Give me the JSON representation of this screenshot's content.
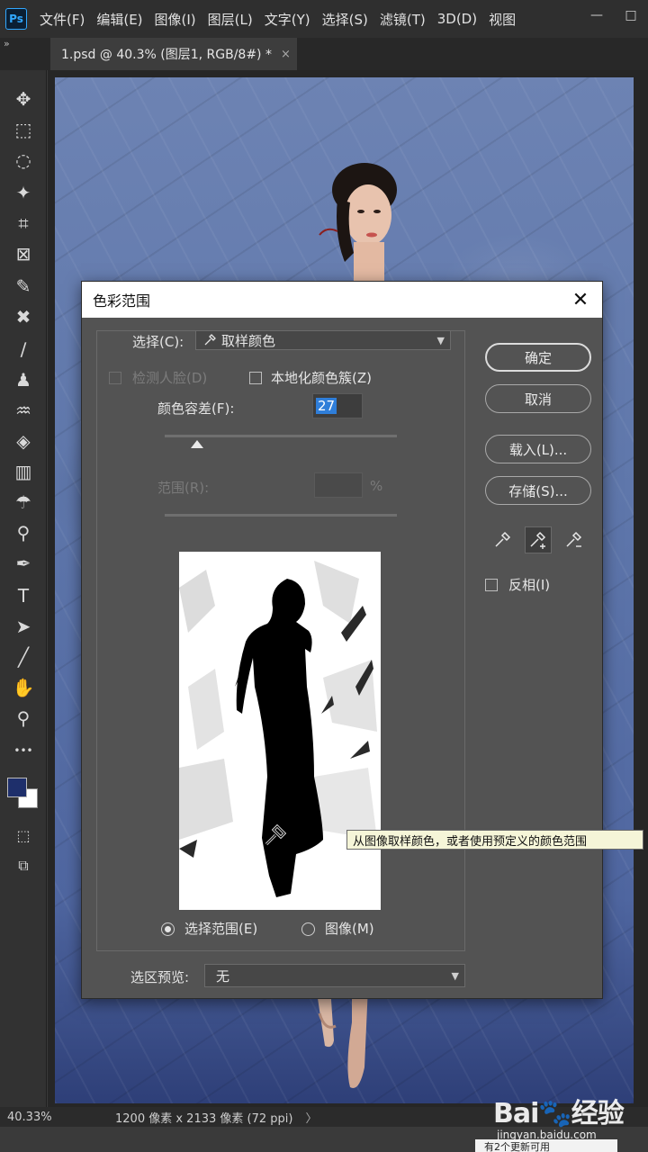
{
  "app": {
    "logo": "Ps",
    "menu": [
      "文件(F)",
      "编辑(E)",
      "图像(I)",
      "图层(L)",
      "文字(Y)",
      "选择(S)",
      "滤镜(T)",
      "3D(D)",
      "视图"
    ],
    "window_controls": {
      "minimize": "—",
      "maximize": "□"
    },
    "panel_toggle": "»"
  },
  "tab": {
    "title": "1.psd @ 40.3% (图层1, RGB/8#) *",
    "close": "×"
  },
  "tools": [
    {
      "name": "move-icon",
      "glyph": "✥"
    },
    {
      "name": "marquee-icon",
      "glyph": "⬚"
    },
    {
      "name": "lasso-icon",
      "glyph": "◌"
    },
    {
      "name": "magic-wand-icon",
      "glyph": "✦"
    },
    {
      "name": "crop-icon",
      "glyph": "⌗"
    },
    {
      "name": "frame-icon",
      "glyph": "⊠"
    },
    {
      "name": "eyedropper-icon",
      "glyph": "✎"
    },
    {
      "name": "healing-icon",
      "glyph": "✖"
    },
    {
      "name": "brush-icon",
      "glyph": "∕"
    },
    {
      "name": "stamp-icon",
      "glyph": "♟"
    },
    {
      "name": "history-brush-icon",
      "glyph": "♒"
    },
    {
      "name": "eraser-icon",
      "glyph": "◈"
    },
    {
      "name": "gradient-icon",
      "glyph": "▥"
    },
    {
      "name": "blur-icon",
      "glyph": "☂"
    },
    {
      "name": "dodge-icon",
      "glyph": "⚲"
    },
    {
      "name": "pen-icon",
      "glyph": "✒"
    },
    {
      "name": "type-icon",
      "glyph": "T"
    },
    {
      "name": "path-select-icon",
      "glyph": "➤"
    },
    {
      "name": "line-icon",
      "glyph": "╱"
    },
    {
      "name": "hand-icon",
      "glyph": "✋"
    },
    {
      "name": "zoom-icon",
      "glyph": "⚲"
    },
    {
      "name": "more-tools-icon",
      "glyph": "•••"
    }
  ],
  "colors": {
    "foreground": "#1e2f6b",
    "background": "#ffffff",
    "accent": "#2f7ed9"
  },
  "dialog": {
    "title": "色彩范围",
    "close": "✕",
    "select_label": "选择(C):",
    "select_value": "取样颜色",
    "detect_faces_label": "检测人脸(D)",
    "localized_label": "本地化颜色簇(Z)",
    "fuzziness_label": "颜色容差(F):",
    "fuzziness_value": "27",
    "fuzziness_fraction": 0.14,
    "range_label": "范围(R):",
    "range_unit": "%",
    "radio_selection": "选择范围(E)",
    "radio_image": "图像(M)",
    "preview_label": "选区预览:",
    "preview_value": "无",
    "buttons": {
      "ok": "确定",
      "cancel": "取消",
      "load": "载入(L)...",
      "save": "存储(S)..."
    },
    "invert_label": "反相(I)"
  },
  "tooltip": "从图像取样颜色，或者使用预定义的颜色范围",
  "status": {
    "zoom": "40.33%",
    "doc": "1200 像素 x 2133 像素 (72 ppi)",
    "arrow": "〉"
  },
  "watermark": {
    "logo": "Bai🐾经验",
    "url": "jingyan.baidu.com"
  },
  "notice": "有2个更新可用"
}
